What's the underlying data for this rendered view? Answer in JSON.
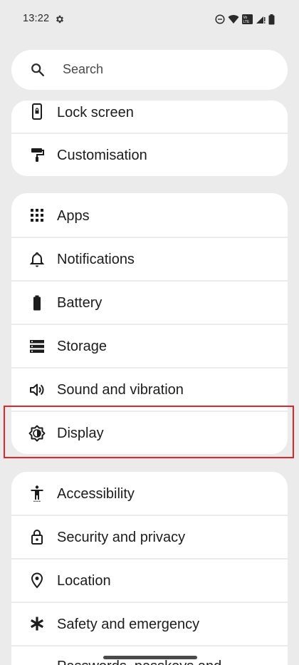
{
  "status_bar": {
    "time": "13:22",
    "network_label": "Vo LTE"
  },
  "search": {
    "placeholder": "Search"
  },
  "settings_items": [
    {
      "id": "lock-screen",
      "label": "Lock screen",
      "icon": "lock-screen-icon"
    },
    {
      "id": "customisation",
      "label": "Customisation",
      "icon": "paint-roller-icon"
    },
    {
      "id": "apps",
      "label": "Apps",
      "icon": "apps-grid-icon"
    },
    {
      "id": "notifications",
      "label": "Notifications",
      "icon": "bell-icon"
    },
    {
      "id": "battery",
      "label": "Battery",
      "icon": "battery-icon"
    },
    {
      "id": "storage",
      "label": "Storage",
      "icon": "storage-icon"
    },
    {
      "id": "sound",
      "label": "Sound and vibration",
      "icon": "speaker-icon"
    },
    {
      "id": "display",
      "label": "Display",
      "icon": "brightness-icon",
      "highlighted": true
    },
    {
      "id": "accessibility",
      "label": "Accessibility",
      "icon": "accessibility-icon"
    },
    {
      "id": "security",
      "label": "Security and privacy",
      "icon": "padlock-icon"
    },
    {
      "id": "location",
      "label": "Location",
      "icon": "location-pin-icon"
    },
    {
      "id": "safety",
      "label": "Safety and emergency",
      "icon": "asterisk-icon"
    },
    {
      "id": "passwords",
      "label": "Passwords, passkeys and",
      "icon": "key-icon"
    }
  ],
  "colors": {
    "background": "#ebebeb",
    "card": "#ffffff",
    "highlight": "#e0252b"
  }
}
